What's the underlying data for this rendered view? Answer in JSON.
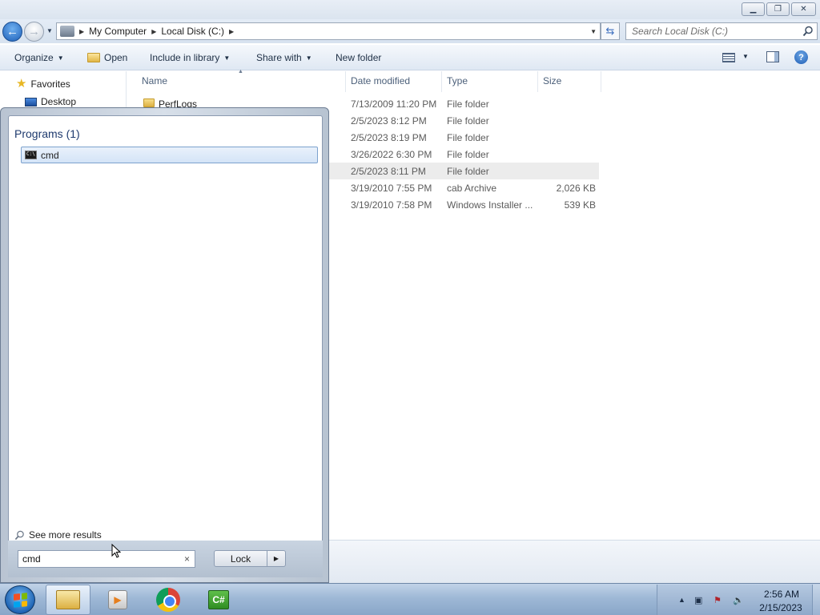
{
  "window": {
    "caption_buttons": [
      "minimize",
      "maximize",
      "close"
    ]
  },
  "address": {
    "crumbs": [
      "My Computer",
      "Local Disk (C:)"
    ],
    "search_placeholder": "Search Local Disk (C:)"
  },
  "toolbar": {
    "organize": "Organize",
    "open": "Open",
    "include_in_library": "Include in library",
    "share_with": "Share with",
    "new_folder": "New folder"
  },
  "navpane": {
    "favorites": "Favorites",
    "desktop": "Desktop"
  },
  "filelist": {
    "columns": [
      "Name",
      "Date modified",
      "Type",
      "Size"
    ],
    "rows": [
      {
        "name": "PerfLogs",
        "date": "7/13/2009 11:20 PM",
        "type": "File folder",
        "size": ""
      },
      {
        "name": "",
        "date": "2/5/2023 8:12 PM",
        "type": "File folder",
        "size": ""
      },
      {
        "name": "",
        "date": "2/5/2023 8:19 PM",
        "type": "File folder",
        "size": ""
      },
      {
        "name": "",
        "date": "3/26/2022 6:30 PM",
        "type": "File folder",
        "size": ""
      },
      {
        "name": "",
        "date": "2/5/2023 8:11 PM",
        "type": "File folder",
        "size": ""
      },
      {
        "name": "",
        "date": "3/19/2010 7:55 PM",
        "type": "cab Archive",
        "size": "2,026 KB"
      },
      {
        "name": "",
        "date": "3/19/2010 7:58 PM",
        "type": "Windows Installer ...",
        "size": "539 KB"
      }
    ]
  },
  "startmenu": {
    "programs_header": "Programs (1)",
    "result": "cmd",
    "see_more": "See more results",
    "search_value": "cmd",
    "clear_glyph": "×",
    "power_button": "Lock"
  },
  "taskbar": {
    "apps": [
      "windows-explorer",
      "windows-media-player",
      "google-chrome",
      "visual-csharp"
    ],
    "clock_time": "2:56 AM",
    "clock_date": "2/15/2023"
  },
  "colors": {
    "selection": "#d4e4f7",
    "accent_blue": "#1e64b5",
    "taskbar": "#9eb8d6"
  }
}
